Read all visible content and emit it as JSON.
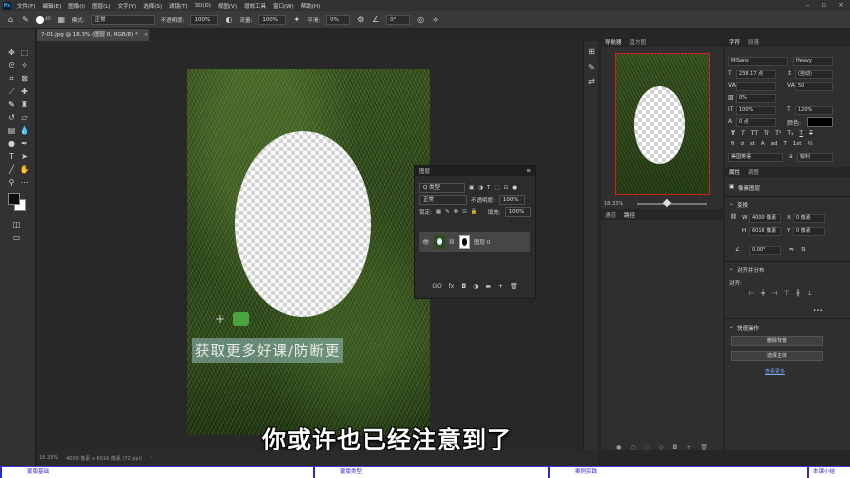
{
  "menu": {
    "app_icon": "Ps",
    "items": [
      "文件(F)",
      "编辑(E)",
      "图像(I)",
      "图层(L)",
      "文字(Y)",
      "选择(S)",
      "滤镜(T)",
      "3D(D)",
      "视图(V)",
      "增效工具",
      "窗口(W)",
      "帮助(H)"
    ]
  },
  "options": {
    "brush_size": "45",
    "mode_label": "模式:",
    "mode_value": "正常",
    "opacity_label": "不透明度:",
    "opacity_value": "100%",
    "flow_label": "流量:",
    "flow_value": "100%",
    "smooth_label": "平滑:",
    "smooth_value": "0%",
    "angle_value": "0°"
  },
  "document": {
    "tab_title": "7-01.jpg @ 18.3% (图层 0, RGB/8) *",
    "close_glyph": "×",
    "status_zoom": "18.33%",
    "status_info": "4000 像素 x 6016 像素 (72 ppi)"
  },
  "watermark": {
    "plus": "+",
    "text": "获取更多好课/防断更"
  },
  "layers_panel": {
    "title": "图层",
    "filter_label": "Q 类型",
    "blend_mode": "正常",
    "opacity_label": "不透明度:",
    "opacity_value": "100%",
    "lock_label": "锁定:",
    "fill_label": "填充:",
    "fill_value": "100%",
    "layer_name": "图层 0",
    "footer_icons": [
      "GO",
      "fx",
      "◘",
      "◑",
      "▬",
      "+",
      "🗑"
    ]
  },
  "subtitle": "你或许也已经注意到了",
  "navigator": {
    "tabs": [
      "导航器",
      "直方图"
    ],
    "zoom": "18.33%"
  },
  "channels": {
    "tabs": [
      "通道",
      "路径"
    ]
  },
  "character": {
    "tabs": [
      "字符",
      "段落"
    ],
    "font_family": "MiSans",
    "font_style": "Heavy",
    "font_size": "238.17 点",
    "leading": "(自动)",
    "kerning": "",
    "tracking": "50",
    "scale_pct": "0%",
    "vscale": "100%",
    "hscale": "120%",
    "baseline": "0 点",
    "color_label": "颜色:",
    "language": "美国英语",
    "antialias": "锐利",
    "aa_prefix": "a",
    "style_buttons": [
      "T",
      "T",
      "TT",
      "Tr",
      "T¹",
      "T₁",
      "T",
      "T"
    ],
    "opentype_buttons": [
      "fi",
      "ơ",
      "st",
      "A",
      "ad",
      "T",
      "1st",
      "½"
    ]
  },
  "properties": {
    "tabs": [
      "属性",
      "调整"
    ],
    "kind": "像素图层",
    "transform_title": "变换",
    "w_label": "W",
    "w_value": "4000 像素",
    "x_label": "X",
    "x_value": "0 像素",
    "h_label": "H",
    "h_value": "6016 像素",
    "y_label": "Y",
    "y_value": "0 像素",
    "angle_value": "0.00°",
    "align_title": "对齐并分布",
    "align_label": "对齐:",
    "more_glyph": "•••",
    "quick_title": "快速操作",
    "btn_remove_bg": "删除背景",
    "btn_select_subject": "选择主体",
    "link_more": "查看更多"
  },
  "chapters": [
    {
      "label": "蒙版基础"
    },
    {
      "label": "蒙版类型"
    },
    {
      "label": "案例实践"
    },
    {
      "label": "本课小结"
    }
  ]
}
